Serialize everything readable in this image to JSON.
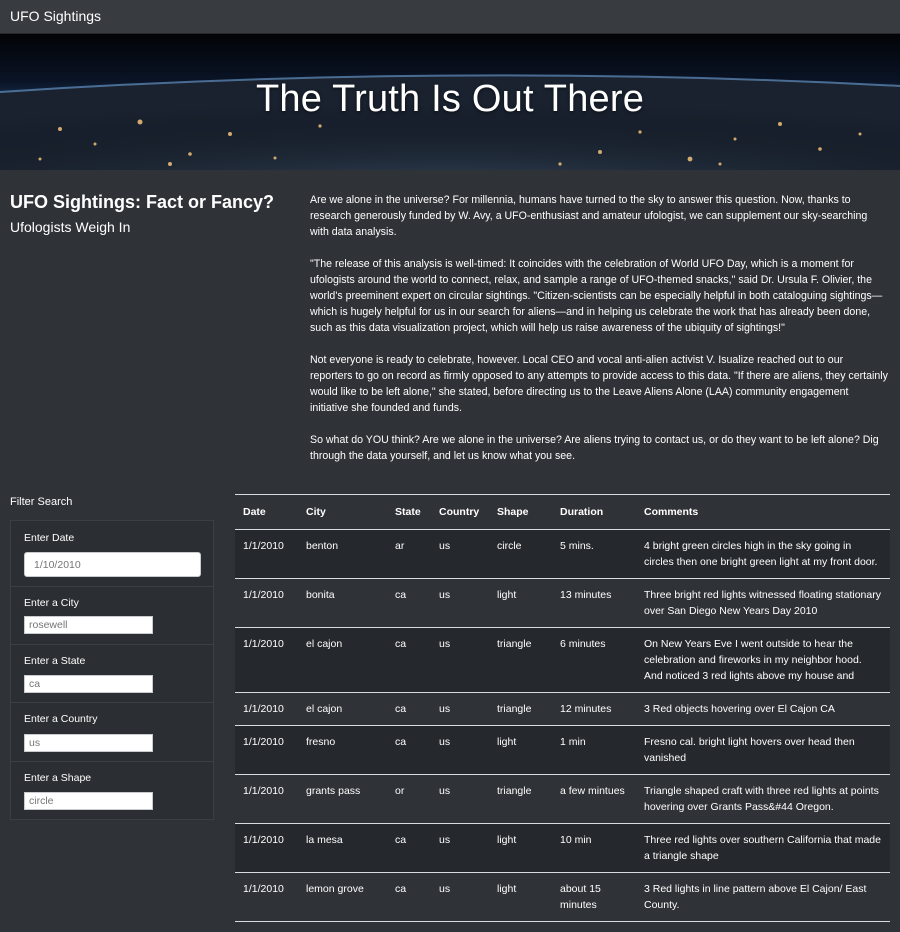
{
  "navbar": {
    "brand": "UFO Sightings"
  },
  "hero": {
    "title": "The Truth Is Out There"
  },
  "intro": {
    "heading": "UFO Sightings: Fact or Fancy?",
    "subheading": "Ufologists Weigh In"
  },
  "article": {
    "paragraphs": [
      "Are we alone in the universe? For millennia, humans have turned to the sky to answer this question. Now, thanks to research generously funded by W. Avy, a UFO-enthusiast and amateur ufologist, we can supplement our sky-searching with data analysis.",
      "\"The release of this analysis is well-timed: It coincides with the celebration of World UFO Day, which is a moment for ufologists around the world to connect, relax, and sample a range of UFO-themed snacks,\" said Dr. Ursula F. Olivier, the world's preeminent expert on circular sightings. \"Citizen-scientists can be especially helpful in both cataloguing sightings—which is hugely helpful for us in our search for aliens—and in helping us celebrate the work that has already been done, such as this data visualization project, which will help us raise awareness of the ubiquity of sightings!\"",
      "Not everyone is ready to celebrate, however. Local CEO and vocal anti-alien activist V. Isualize reached out to our reporters to go on record as firmly opposed to any attempts to provide access to this data. \"If there are aliens, they certainly would like to be left alone,\" she stated, before directing us to the Leave Aliens Alone (LAA) community engagement initiative she founded and funds.",
      "So what do YOU think? Are we alone in the universe? Are aliens trying to contact us, or do they want to be left alone? Dig through the data yourself, and let us know what you see."
    ]
  },
  "filters": {
    "title": "Filter Search",
    "date": {
      "label": "Enter Date",
      "placeholder": "1/10/2010"
    },
    "city": {
      "label": "Enter a City",
      "placeholder": "rosewell"
    },
    "state": {
      "label": "Enter a State",
      "placeholder": "ca"
    },
    "country": {
      "label": "Enter a Country",
      "placeholder": "us"
    },
    "shape": {
      "label": "Enter a Shape",
      "placeholder": "circle"
    }
  },
  "table": {
    "headers": [
      "Date",
      "City",
      "State",
      "Country",
      "Shape",
      "Duration",
      "Comments"
    ],
    "rows": [
      [
        "1/1/2010",
        "benton",
        "ar",
        "us",
        "circle",
        "5 mins.",
        "4 bright green circles high in the sky going in circles then one bright green light at my front door."
      ],
      [
        "1/1/2010",
        "bonita",
        "ca",
        "us",
        "light",
        "13 minutes",
        "Three bright red lights witnessed floating stationary over San Diego New Years Day 2010"
      ],
      [
        "1/1/2010",
        "el cajon",
        "ca",
        "us",
        "triangle",
        "6 minutes",
        "On New Years Eve I went outside to hear the celebration and fireworks in my neighbor hood. And noticed 3 red lights above my house and"
      ],
      [
        "1/1/2010",
        "el cajon",
        "ca",
        "us",
        "triangle",
        "12 minutes",
        "3 Red objects hovering over El Cajon CA"
      ],
      [
        "1/1/2010",
        "fresno",
        "ca",
        "us",
        "light",
        "1 min",
        "Fresno cal. bright light hovers over head then vanished"
      ],
      [
        "1/1/2010",
        "grants pass",
        "or",
        "us",
        "triangle",
        "a few mintues",
        "Triangle shaped craft with three red lights at points hovering over Grants Pass&#44 Oregon."
      ],
      [
        "1/1/2010",
        "la mesa",
        "ca",
        "us",
        "light",
        "10 min",
        "Three red lights over southern California that made a triangle shape"
      ],
      [
        "1/1/2010",
        "lemon grove",
        "ca",
        "us",
        "light",
        "about 15 minutes",
        "3 Red lights in line pattern above El Cajon/ East County."
      ]
    ]
  }
}
